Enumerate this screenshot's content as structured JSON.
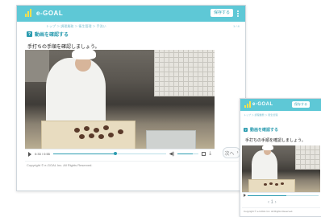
{
  "brand": {
    "name": "e-GOAL",
    "accent": "#5ec8d6",
    "logo_color": "#ffe04a"
  },
  "header": {
    "button_label": "保存する"
  },
  "breadcrumb": {
    "text": "トップ ＞ 調理業務 ＞ 衛生管理 ＞ 手洗い",
    "right": "1 / 4"
  },
  "section": {
    "icon": "question-icon",
    "heading": "動画を確認する",
    "prompt": "手打ちの手順を確認しましょう。"
  },
  "video": {
    "time": "0:33 / 0:55",
    "progress": 0.55,
    "volume": 0.7,
    "icons": [
      "play-icon",
      "volume-icon",
      "fullscreen-icon",
      "download-icon"
    ]
  },
  "navigation": {
    "next_label": "次へ",
    "next_icon": "chevron-right-icon"
  },
  "footer": {
    "copyright": "Copyright © e-GOAL Inc. All Rights Reserved."
  },
  "mobile": {
    "brand_name": "e-GOAL",
    "header_button": "保存する",
    "breadcrumb": "トップ ＞ 調理業務 ＞ 衛生管理",
    "heading": "動画を確認する",
    "prompt": "手打ちの手順を確認しましょう。",
    "pager": "‹ 1 ›",
    "copyright": "Copyright © e-GOAL Inc. All Rights Reserved."
  }
}
